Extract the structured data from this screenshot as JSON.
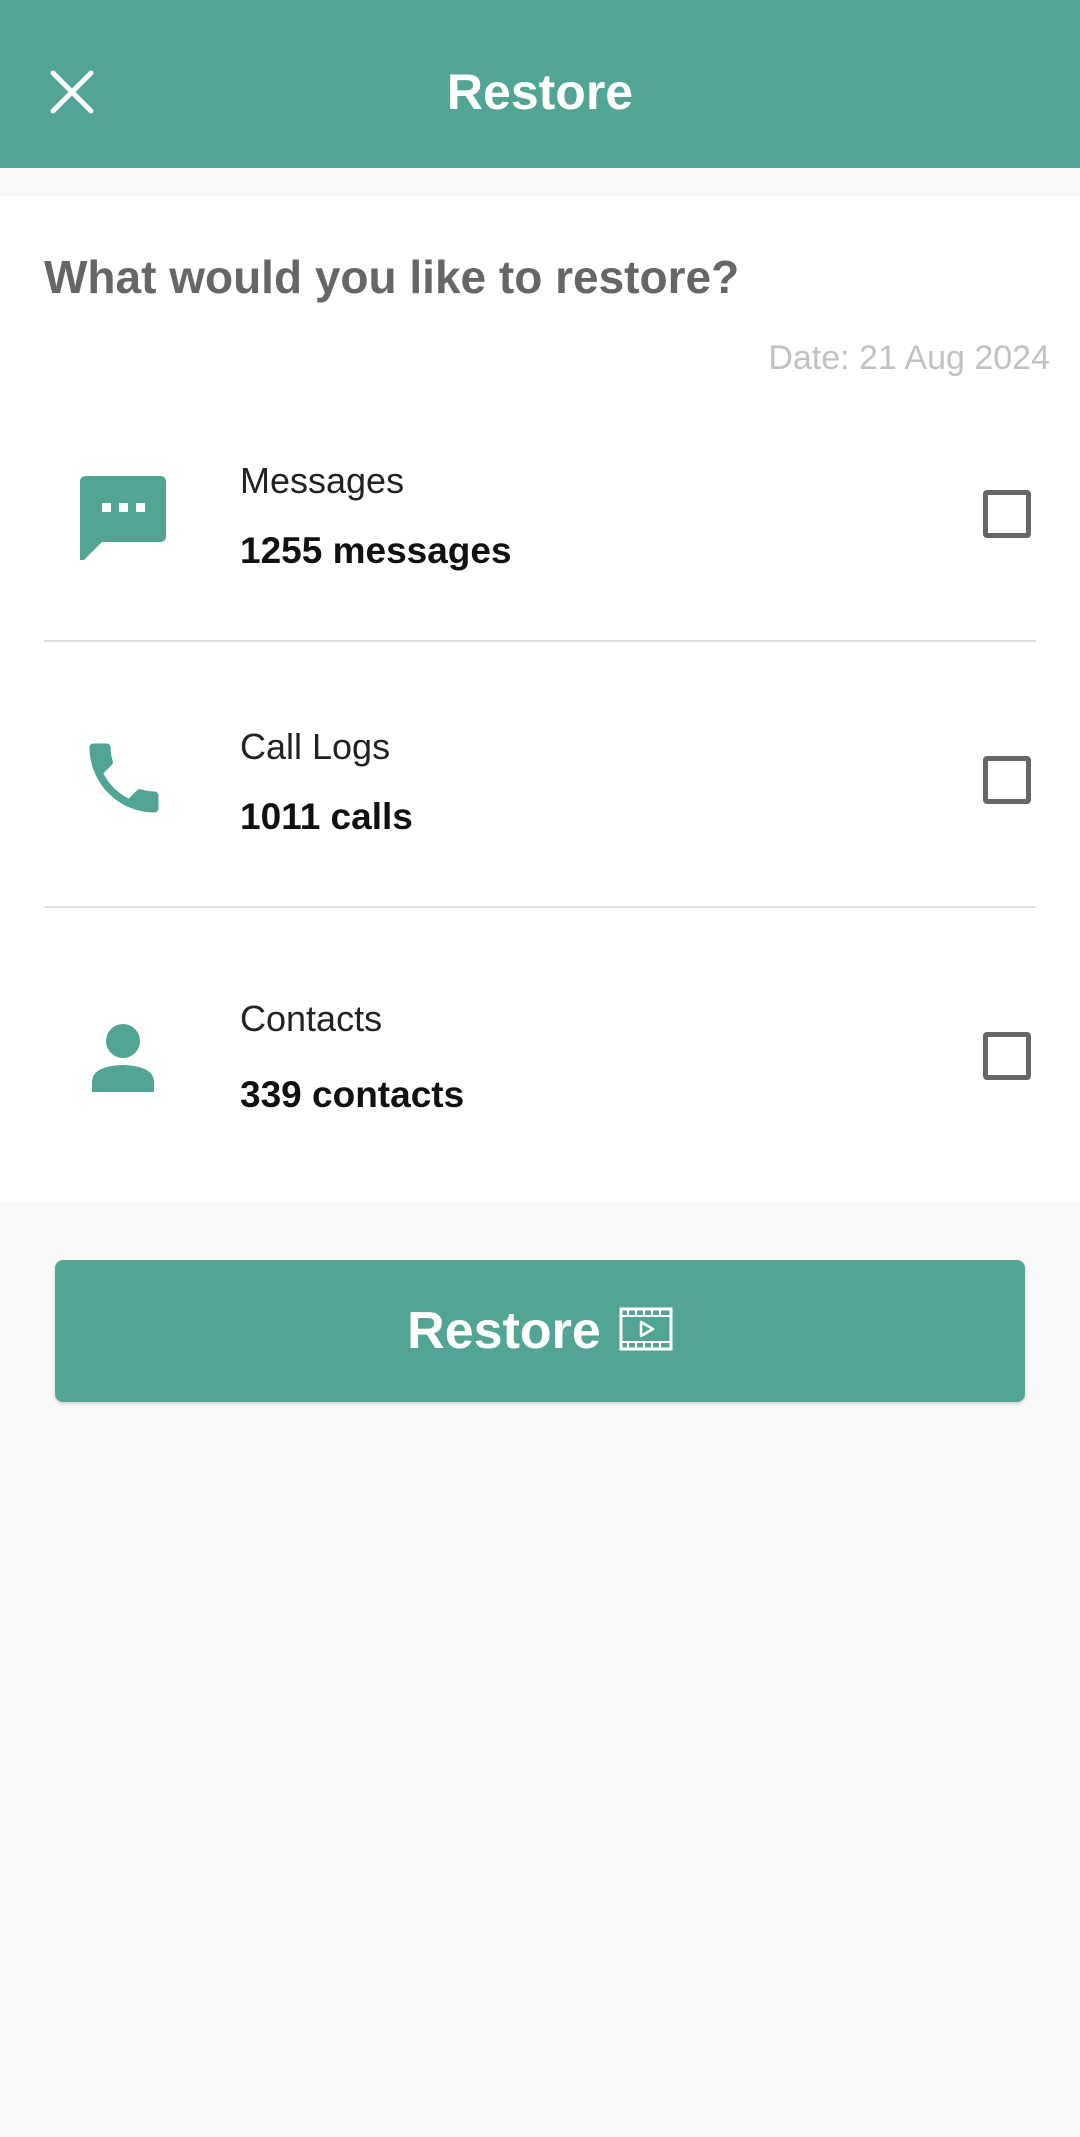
{
  "header": {
    "title": "Restore",
    "close_icon": "close-icon"
  },
  "content": {
    "question": "What would you like to restore?",
    "date": "Date: 21 Aug 2024"
  },
  "items": [
    {
      "label": "Messages",
      "count": "1255 messages",
      "icon": "message-icon",
      "checked": false
    },
    {
      "label": "Call Logs",
      "count": "1011 calls",
      "icon": "phone-icon",
      "checked": false
    },
    {
      "label": "Contacts",
      "count": "339 contacts",
      "icon": "person-icon",
      "checked": false
    }
  ],
  "action": {
    "restore_label": "Restore",
    "restore_icon": "video-ad-icon"
  },
  "colors": {
    "accent": "#52a595",
    "background": "#f9f9f9",
    "card": "#ffffff"
  }
}
